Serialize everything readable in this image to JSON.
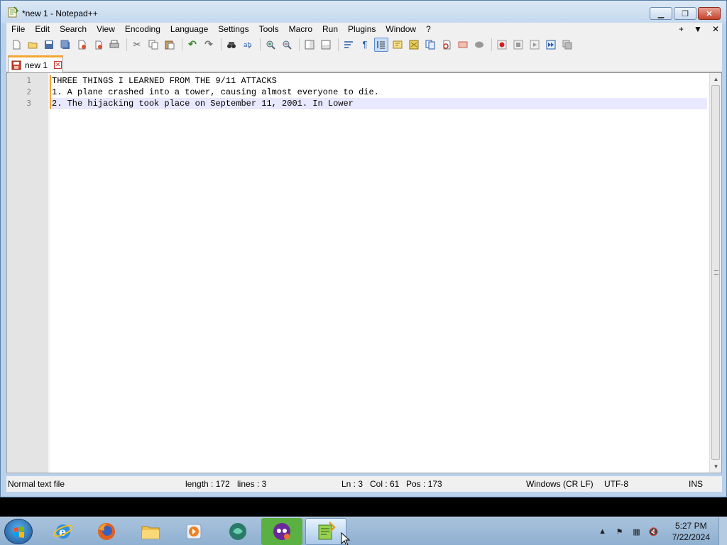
{
  "window": {
    "title": "*new 1 - Notepad++",
    "controls": [
      "minimize",
      "maximize",
      "close"
    ]
  },
  "menu": {
    "items": [
      "File",
      "Edit",
      "Search",
      "View",
      "Encoding",
      "Language",
      "Settings",
      "Tools",
      "Macro",
      "Run",
      "Plugins",
      "Window",
      "?"
    ],
    "right": [
      "+",
      "▼",
      "✕"
    ]
  },
  "toolbar": {
    "buttons": [
      "new-file",
      "open",
      "save",
      "save-all",
      "close",
      "close-all",
      "print",
      "cut",
      "copy",
      "paste",
      "undo",
      "redo",
      "find",
      "replace",
      "zoom-in",
      "zoom-out",
      "sync-vertical",
      "sync-horizontal",
      "word-wrap",
      "show-all-chars",
      "indent-guide",
      "user-language",
      "document-map",
      "function-list",
      "folder-as-workspace",
      "monitoring",
      "record-macro",
      "stop-recording",
      "playback-macro",
      "run-macro-multiple",
      "save-macro"
    ]
  },
  "tab": {
    "label": "new 1"
  },
  "editor": {
    "line_numbers": [
      "1",
      "2",
      "3"
    ],
    "lines": [
      "THREE THINGS I LEARNED FROM THE 9/11 ATTACKS",
      "1. A plane crashed into a tower, causing almost everyone to die.",
      "2. The hijacking took place on September 11, 2001. In Lower"
    ],
    "current_line": 3
  },
  "status": {
    "file_type": "Normal text file",
    "length": "length : 172",
    "lines": "lines : 3",
    "ln": "Ln : 3",
    "col": "Col : 61",
    "pos": "Pos : 173",
    "eol": "Windows (CR LF)",
    "encoding": "UTF-8",
    "mode": "INS"
  },
  "taskbar": {
    "apps": [
      "internet-explorer",
      "firefox",
      "file-explorer",
      "media-player",
      "app-green",
      "app-purple",
      "notepad-plus-plus"
    ],
    "active_app": "notepad-plus-plus",
    "clock_time": "5:27 PM",
    "clock_date": "7/22/2024"
  },
  "colors": {
    "tab_accent": "#f6a633",
    "current_line": "#e8e8ff",
    "gutter": "#e4e4e4",
    "taskbar": "#a9c3dd"
  }
}
